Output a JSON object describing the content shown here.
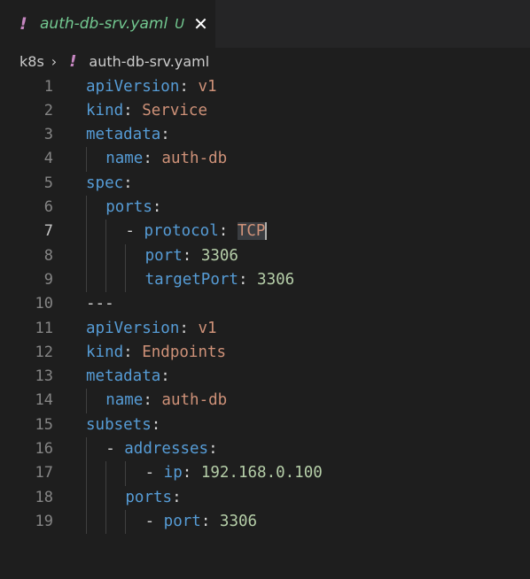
{
  "tab": {
    "icon": "yaml-exclamation-icon",
    "icon_glyph": "!",
    "title": "auth-db-srv.yaml",
    "status": "U",
    "close_glyph": "✕"
  },
  "breadcrumb": {
    "folder": "k8s",
    "separator": "›",
    "icon_glyph": "!",
    "file": "auth-db-srv.yaml"
  },
  "editor": {
    "active_line": 7,
    "lines": [
      {
        "num": "1",
        "indent": "",
        "tokens": [
          [
            "k",
            "apiVersion"
          ],
          [
            "p",
            ": "
          ],
          [
            "s",
            "v1"
          ]
        ]
      },
      {
        "num": "2",
        "indent": "",
        "tokens": [
          [
            "k",
            "kind"
          ],
          [
            "p",
            ": "
          ],
          [
            "s",
            "Service"
          ]
        ]
      },
      {
        "num": "3",
        "indent": "",
        "tokens": [
          [
            "k",
            "metadata"
          ],
          [
            "p",
            ":"
          ]
        ]
      },
      {
        "num": "4",
        "indent": "  ",
        "tokens": [
          [
            "k",
            "name"
          ],
          [
            "p",
            ": "
          ],
          [
            "s",
            "auth-db"
          ]
        ]
      },
      {
        "num": "5",
        "indent": "",
        "tokens": [
          [
            "k",
            "spec"
          ],
          [
            "p",
            ":"
          ]
        ]
      },
      {
        "num": "6",
        "indent": "  ",
        "tokens": [
          [
            "k",
            "ports"
          ],
          [
            "p",
            ":"
          ]
        ]
      },
      {
        "num": "7",
        "indent": "    ",
        "tokens": [
          [
            "p",
            "- "
          ],
          [
            "k",
            "protocol"
          ],
          [
            "p",
            ": "
          ],
          [
            "s",
            "TCP"
          ]
        ]
      },
      {
        "num": "8",
        "indent": "      ",
        "tokens": [
          [
            "k",
            "port"
          ],
          [
            "p",
            ": "
          ],
          [
            "n",
            "3306"
          ]
        ]
      },
      {
        "num": "9",
        "indent": "      ",
        "tokens": [
          [
            "k",
            "targetPort"
          ],
          [
            "p",
            ": "
          ],
          [
            "n",
            "3306"
          ]
        ]
      },
      {
        "num": "10",
        "indent": "",
        "tokens": [
          [
            "p",
            "---"
          ]
        ]
      },
      {
        "num": "11",
        "indent": "",
        "tokens": [
          [
            "k",
            "apiVersion"
          ],
          [
            "p",
            ": "
          ],
          [
            "s",
            "v1"
          ]
        ]
      },
      {
        "num": "12",
        "indent": "",
        "tokens": [
          [
            "k",
            "kind"
          ],
          [
            "p",
            ": "
          ],
          [
            "s",
            "Endpoints"
          ]
        ]
      },
      {
        "num": "13",
        "indent": "",
        "tokens": [
          [
            "k",
            "metadata"
          ],
          [
            "p",
            ":"
          ]
        ]
      },
      {
        "num": "14",
        "indent": "  ",
        "tokens": [
          [
            "k",
            "name"
          ],
          [
            "p",
            ": "
          ],
          [
            "s",
            "auth-db"
          ]
        ]
      },
      {
        "num": "15",
        "indent": "",
        "tokens": [
          [
            "k",
            "subsets"
          ],
          [
            "p",
            ":"
          ]
        ]
      },
      {
        "num": "16",
        "indent": "  ",
        "tokens": [
          [
            "p",
            "- "
          ],
          [
            "k",
            "addresses"
          ],
          [
            "p",
            ":"
          ]
        ]
      },
      {
        "num": "17",
        "indent": "      ",
        "tokens": [
          [
            "p",
            "- "
          ],
          [
            "k",
            "ip"
          ],
          [
            "p",
            ": "
          ],
          [
            "n",
            "192.168.0.100"
          ]
        ]
      },
      {
        "num": "18",
        "indent": "    ",
        "tokens": [
          [
            "k",
            "ports"
          ],
          [
            "p",
            ":"
          ]
        ]
      },
      {
        "num": "19",
        "indent": "      ",
        "tokens": [
          [
            "p",
            "- "
          ],
          [
            "k",
            "port"
          ],
          [
            "p",
            ": "
          ],
          [
            "n",
            "3306"
          ]
        ]
      }
    ]
  },
  "colors": {
    "keyword": "#569cd6",
    "string": "#ce9178",
    "number": "#b5cea8",
    "untracked": "#73c991",
    "yaml_icon": "#c586c0"
  }
}
